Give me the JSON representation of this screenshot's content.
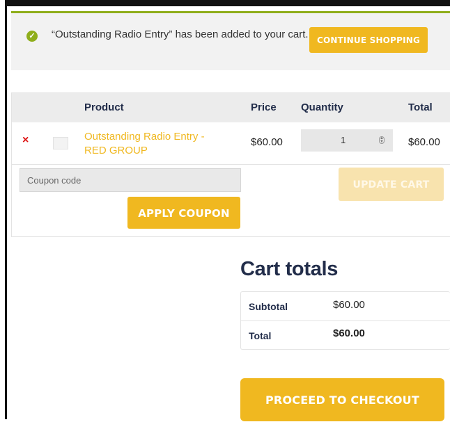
{
  "notice": {
    "message": "“Outstanding Radio Entry” has been added to your cart.",
    "continue_label": "Continue shopping"
  },
  "cart": {
    "headers": {
      "product": "Product",
      "price": "Price",
      "quantity": "Quantity",
      "total": "Total"
    },
    "items": [
      {
        "remove": "×",
        "name": "Outstanding Radio Entry - RED GROUP",
        "price": "$60.00",
        "quantity": "1",
        "total": "$60.00"
      }
    ],
    "coupon_placeholder": "Coupon code",
    "apply_label": "Apply coupon",
    "update_label": "Update cart"
  },
  "totals": {
    "title": "Cart totals",
    "subtotal_label": "Subtotal",
    "subtotal_value": "$60.00",
    "total_label": "Total",
    "total_value": "$60.00",
    "checkout_label": "Proceed to checkout"
  },
  "colors": {
    "accent": "#f0b820",
    "success": "#8fae1b",
    "heading": "#222d4a",
    "remove": "#dd1111"
  },
  "icons": {
    "notice": "check-circle-icon",
    "remove": "remove-icon",
    "spinner": "stepper-icon"
  }
}
